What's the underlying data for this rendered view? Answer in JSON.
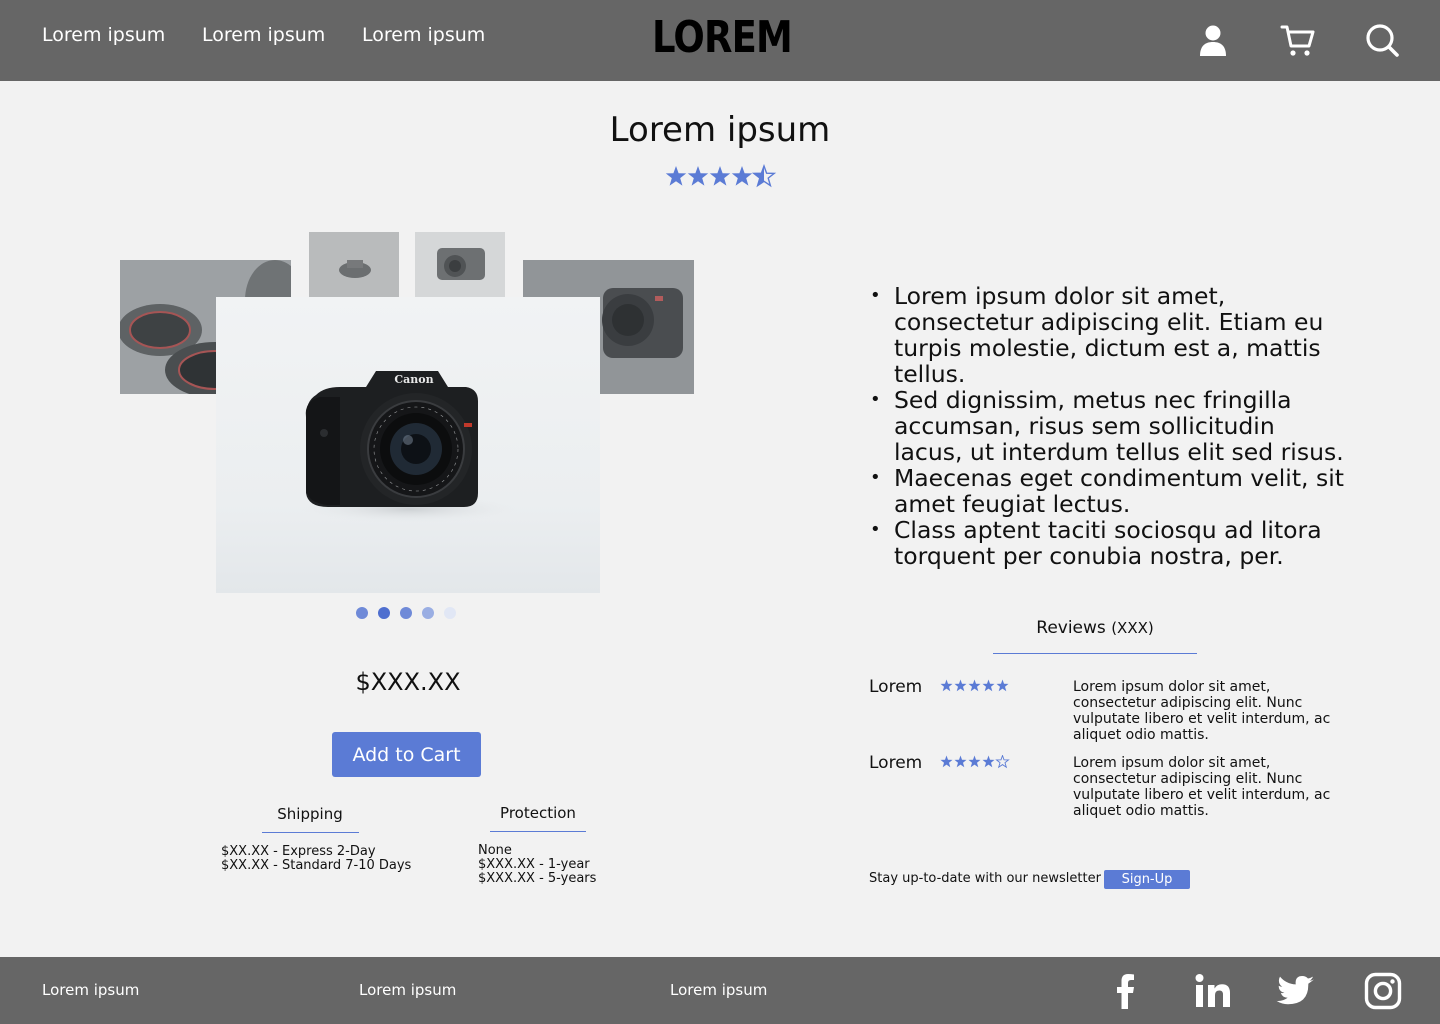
{
  "header": {
    "nav": [
      "Lorem ipsum",
      "Lorem ipsum",
      "Lorem ipsum"
    ],
    "logo": "LOREM",
    "icons": [
      "user-icon",
      "cart-icon",
      "search-icon"
    ]
  },
  "product": {
    "title": "Lorem ipsum",
    "rating": 4.5,
    "rating_max": 5,
    "price": "$XXX.XX",
    "add_to_cart": "Add to Cart",
    "main_image_logo_text": "Canon",
    "gallery_dots": 5,
    "gallery_active_dot": 2
  },
  "shipping": {
    "label": "Shipping",
    "options": [
      "$XX.XX - Express 2-Day",
      "$XX.XX - Standard 7-10 Days"
    ]
  },
  "protection": {
    "label": "Protection",
    "options": [
      "None",
      "$XXX.XX - 1-year",
      "$XXX.XX - 5-years"
    ]
  },
  "description": [
    "Lorem ipsum dolor sit amet, consectetur adipiscing elit. Etiam eu turpis molestie, dictum est a, mattis tellus.",
    "Sed dignissim, metus nec fringilla accumsan, risus sem sollicitudin lacus, ut interdum tellus elit sed risus.",
    "Maecenas eget condimentum velit, sit amet feugiat lectus.",
    "Class aptent taciti sociosqu ad litora torquent per conubia nostra, per."
  ],
  "reviews": {
    "label": "Reviews",
    "count": "(XXX)",
    "items": [
      {
        "name": "Lorem",
        "rating": 5,
        "text": "Lorem ipsum dolor sit amet, consectetur adipiscing elit. Nunc vulputate libero et velit interdum, ac aliquet odio mattis."
      },
      {
        "name": "Lorem",
        "rating": 4,
        "text": "Lorem ipsum dolor sit amet, consectetur adipiscing elit. Nunc vulputate libero et velit interdum, ac aliquet odio mattis."
      }
    ]
  },
  "newsletter": {
    "text": "Stay up-to-date with our newsletter",
    "button": "Sign-Up"
  },
  "footer": {
    "links": [
      "Lorem ipsum",
      "Lorem ipsum",
      "Lorem ipsum"
    ],
    "social": [
      "facebook-icon",
      "linkedin-icon",
      "twitter-icon",
      "instagram-icon"
    ]
  },
  "colors": {
    "accent": "#5b7bd5",
    "header_bg": "#666666",
    "page_bg": "#f2f2f2"
  }
}
